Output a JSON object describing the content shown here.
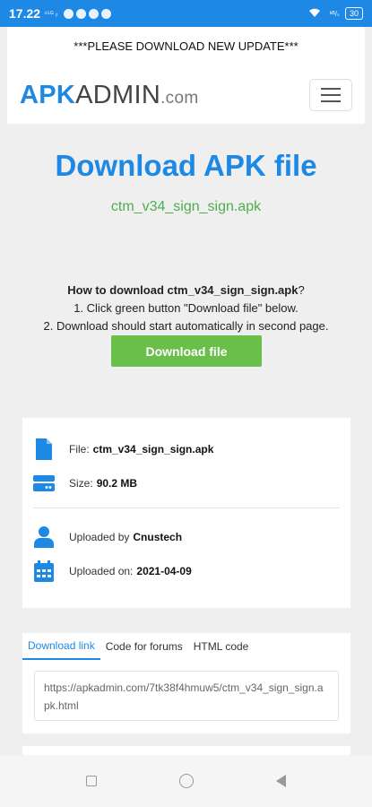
{
  "status": {
    "time": "17.22",
    "indicators": "⁴⁵ᴳ ᵢₗ",
    "wifi_text": "ᵏᴮ/ₛ",
    "battery": "30"
  },
  "header": {
    "notice": "***PLEASE DOWNLOAD NEW UPDATE***",
    "logo_apk": "APK",
    "logo_admin": "ADMIN",
    "logo_com": ".com"
  },
  "main": {
    "title": "Download APK file",
    "filename": "ctm_v34_sign_sign.apk",
    "howto_heading": "How to download ctm_v34_sign_sign.apk",
    "howto_q": "?",
    "step1": "1. Click green button \"Download file\" below.",
    "step2": "2. Download should start automatically in second page.",
    "download_button": "Download file"
  },
  "info": {
    "file_label": "File:",
    "file_value": "ctm_v34_sign_sign.apk",
    "size_label": "Size:",
    "size_value": "90.2 MB",
    "uploader_label": "Uploaded by",
    "uploader_value": "Cnustech",
    "date_label": "Uploaded on:",
    "date_value": "2021-04-09"
  },
  "tabs": {
    "items": [
      "Download link",
      "Code for forums",
      "HTML code"
    ],
    "active": "Download link",
    "link_value": "https://apkadmin.com/7tk38f4hmuw5/ctm_v34_sign_sign.apk.html"
  },
  "colors": {
    "accent": "#1e88e5",
    "green": "#4caf50",
    "button": "#6abf4b"
  }
}
